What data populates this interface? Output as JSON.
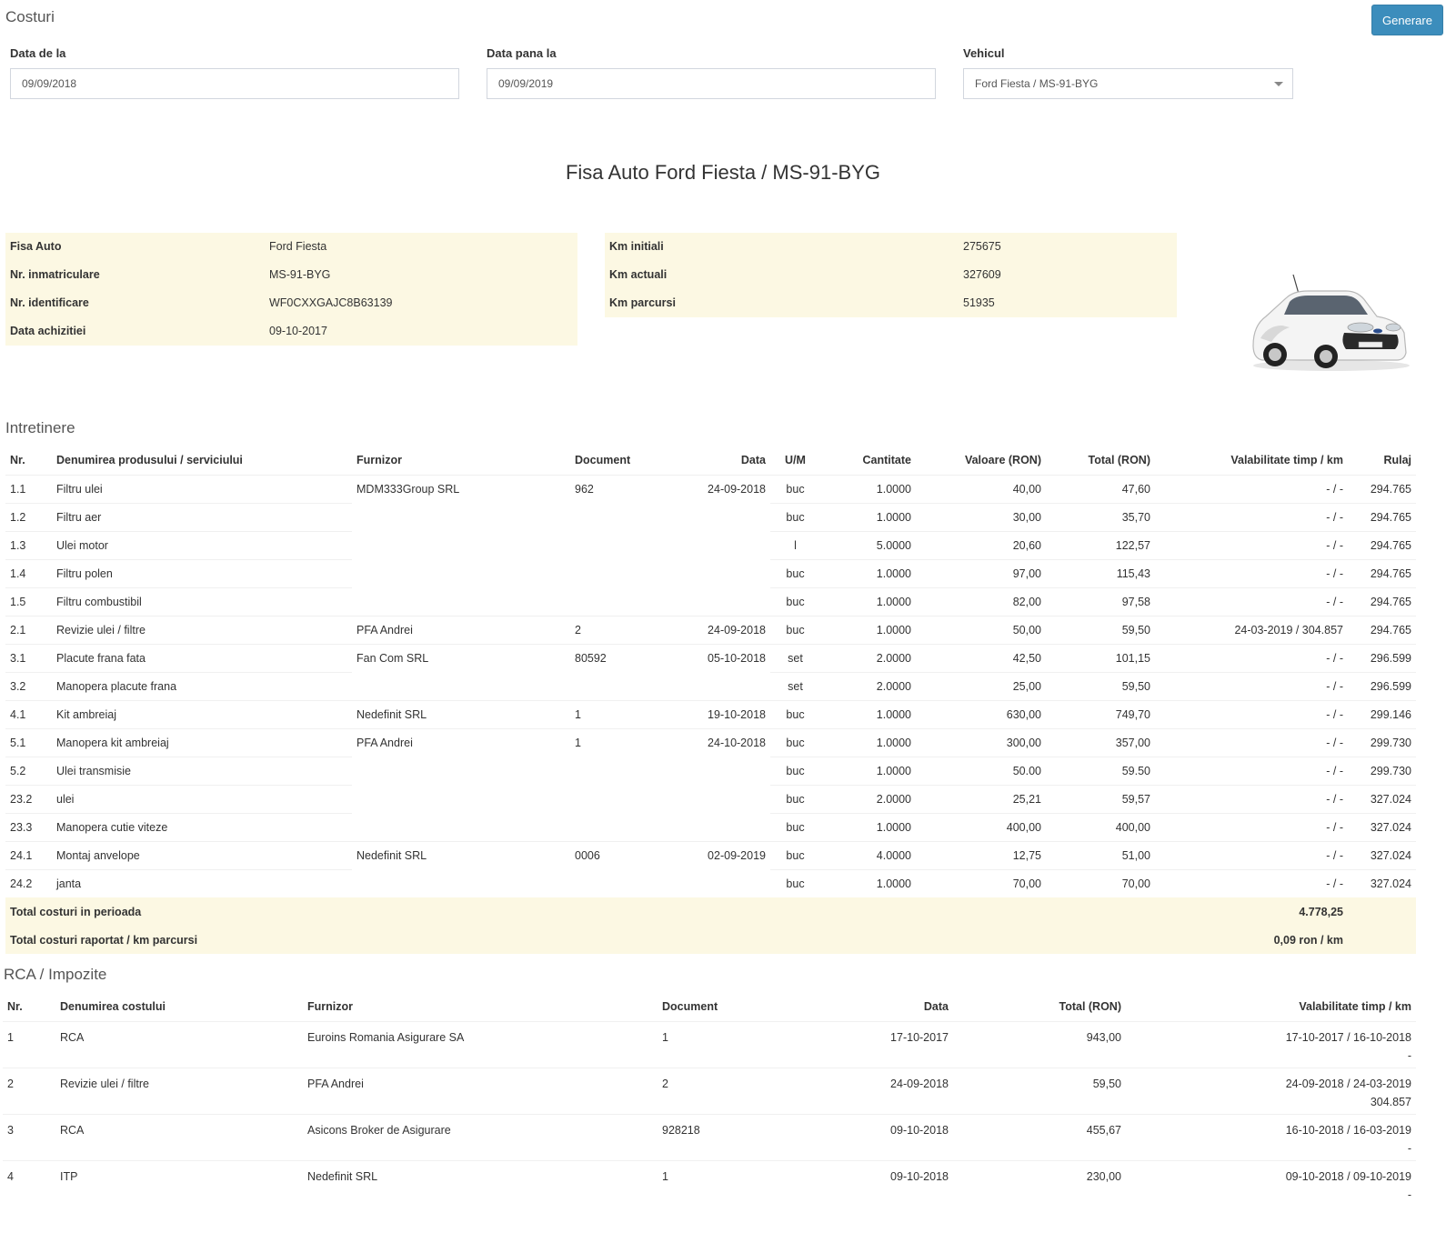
{
  "header": {
    "title": "Costuri",
    "generate_label": "Generare"
  },
  "filters": {
    "date_from": {
      "label": "Data de la",
      "value": "09/09/2018"
    },
    "date_to": {
      "label": "Data pana la",
      "value": "09/09/2019"
    },
    "vehicle": {
      "label": "Vehicul",
      "value": "Ford Fiesta / MS-91-BYG"
    }
  },
  "card": {
    "title": "Fisa Auto Ford Fiesta / MS-91-BYG"
  },
  "vehicle_info": [
    {
      "label": "Fisa Auto",
      "value": "Ford Fiesta"
    },
    {
      "label": "Nr. inmatriculare",
      "value": "MS-91-BYG"
    },
    {
      "label": "Nr. identificare",
      "value": "WF0CXXGAJC8B63139"
    },
    {
      "label": "Data achizitiei",
      "value": "09-10-2017"
    }
  ],
  "km_info": [
    {
      "label": "Km initiali",
      "value": "275675"
    },
    {
      "label": "Km actuali",
      "value": "327609"
    },
    {
      "label": "Km parcursi",
      "value": "51935"
    }
  ],
  "maintenance": {
    "title": "Intretinere",
    "columns": [
      "Nr.",
      "Denumirea produsului / serviciului",
      "Furnizor",
      "Document",
      "Data",
      "U/M",
      "Cantitate",
      "Valoare (RON)",
      "Total (RON)",
      "Valabilitate timp / km",
      "Rulaj"
    ],
    "rows": [
      [
        "1.1",
        "Filtru ulei",
        "MDM333Group SRL",
        "962",
        "24-09-2018",
        "buc",
        "1.0000",
        "40,00",
        "47,60",
        "- / -",
        "294.765"
      ],
      [
        "1.2",
        "Filtru aer",
        "",
        "",
        "",
        "buc",
        "1.0000",
        "30,00",
        "35,70",
        "- / -",
        "294.765"
      ],
      [
        "1.3",
        "Ulei motor",
        "",
        "",
        "",
        "l",
        "5.0000",
        "20,60",
        "122,57",
        "- / -",
        "294.765"
      ],
      [
        "1.4",
        "Filtru polen",
        "",
        "",
        "",
        "buc",
        "1.0000",
        "97,00",
        "115,43",
        "- / -",
        "294.765"
      ],
      [
        "1.5",
        "Filtru combustibil",
        "",
        "",
        "",
        "buc",
        "1.0000",
        "82,00",
        "97,58",
        "- / -",
        "294.765"
      ],
      [
        "2.1",
        "Revizie ulei / filtre",
        "PFA Andrei",
        "2",
        "24-09-2018",
        "buc",
        "1.0000",
        "50,00",
        "59,50",
        "24-03-2019 / 304.857",
        "294.765"
      ],
      [
        "3.1",
        "Placute frana fata",
        "Fan Com SRL",
        "80592",
        "05-10-2018",
        "set",
        "2.0000",
        "42,50",
        "101,15",
        "- / -",
        "296.599"
      ],
      [
        "3.2",
        "Manopera placute frana",
        "",
        "",
        "",
        "set",
        "2.0000",
        "25,00",
        "59,50",
        "- / -",
        "296.599"
      ],
      [
        "4.1",
        "Kit ambreiaj",
        "Nedefinit SRL",
        "1",
        "19-10-2018",
        "buc",
        "1.0000",
        "630,00",
        "749,70",
        "- / -",
        "299.146"
      ],
      [
        "5.1",
        "Manopera kit ambreiaj",
        "PFA Andrei",
        "1",
        "24-10-2018",
        "buc",
        "1.0000",
        "300,00",
        "357,00",
        "- / -",
        "299.730"
      ],
      [
        "5.2",
        "Ulei transmisie",
        "",
        "",
        "",
        "buc",
        "1.0000",
        "50.00",
        "59.50",
        "- / -",
        "299.730"
      ],
      [
        "23.2",
        "ulei",
        "",
        "",
        "",
        "buc",
        "2.0000",
        "25,21",
        "59,57",
        "- / -",
        "327.024"
      ],
      [
        "23.3",
        "Manopera cutie viteze",
        "",
        "",
        "",
        "buc",
        "1.0000",
        "400,00",
        "400,00",
        "- / -",
        "327.024"
      ],
      [
        "24.1",
        "Montaj anvelope",
        "Nedefinit SRL",
        "0006",
        "02-09-2019",
        "buc",
        "4.0000",
        "12,75",
        "51,00",
        "- / -",
        "327.024"
      ],
      [
        "24.2",
        "janta",
        "",
        "",
        "",
        "buc",
        "1.0000",
        "70,00",
        "70,00",
        "- / -",
        "327.024"
      ]
    ],
    "totals": [
      {
        "label": "Total costuri in perioada",
        "value": "4.778,25"
      },
      {
        "label": "Total costuri raportat / km parcursi",
        "value": "0,09 ron / km"
      }
    ]
  },
  "rca": {
    "title": "RCA / Impozite",
    "columns": [
      "Nr.",
      "Denumirea costului",
      "Furnizor",
      "Document",
      "Data",
      "Total (RON)",
      "Valabilitate timp / km"
    ],
    "rows": [
      {
        "nr": "1",
        "name": "RCA",
        "supplier": "Euroins Romania Asigurare SA",
        "doc": "1",
        "date": "17-10-2017",
        "total": "943,00",
        "valid_time": "17-10-2017 / 16-10-2018",
        "valid_km": "-"
      },
      {
        "nr": "2",
        "name": "Revizie ulei / filtre",
        "supplier": "PFA Andrei",
        "doc": "2",
        "date": "24-09-2018",
        "total": "59,50",
        "valid_time": "24-09-2018 / 24-03-2019",
        "valid_km": "304.857"
      },
      {
        "nr": "3",
        "name": "RCA",
        "supplier": "Asicons Broker de Asigurare",
        "doc": "928218",
        "date": "09-10-2018",
        "total": "455,67",
        "valid_time": "16-10-2018 / 16-03-2019",
        "valid_km": "-"
      },
      {
        "nr": "4",
        "name": "ITP",
        "supplier": "Nedefinit SRL",
        "doc": "1",
        "date": "09-10-2018",
        "total": "230,00",
        "valid_time": "09-10-2018 / 09-10-2019",
        "valid_km": "-"
      }
    ]
  },
  "colors": {
    "primary": "#3c8dbc",
    "highlight": "#fcf8e3"
  },
  "icons": {
    "vehicle_caret": "chevron-down-icon",
    "car": "car-photo"
  }
}
